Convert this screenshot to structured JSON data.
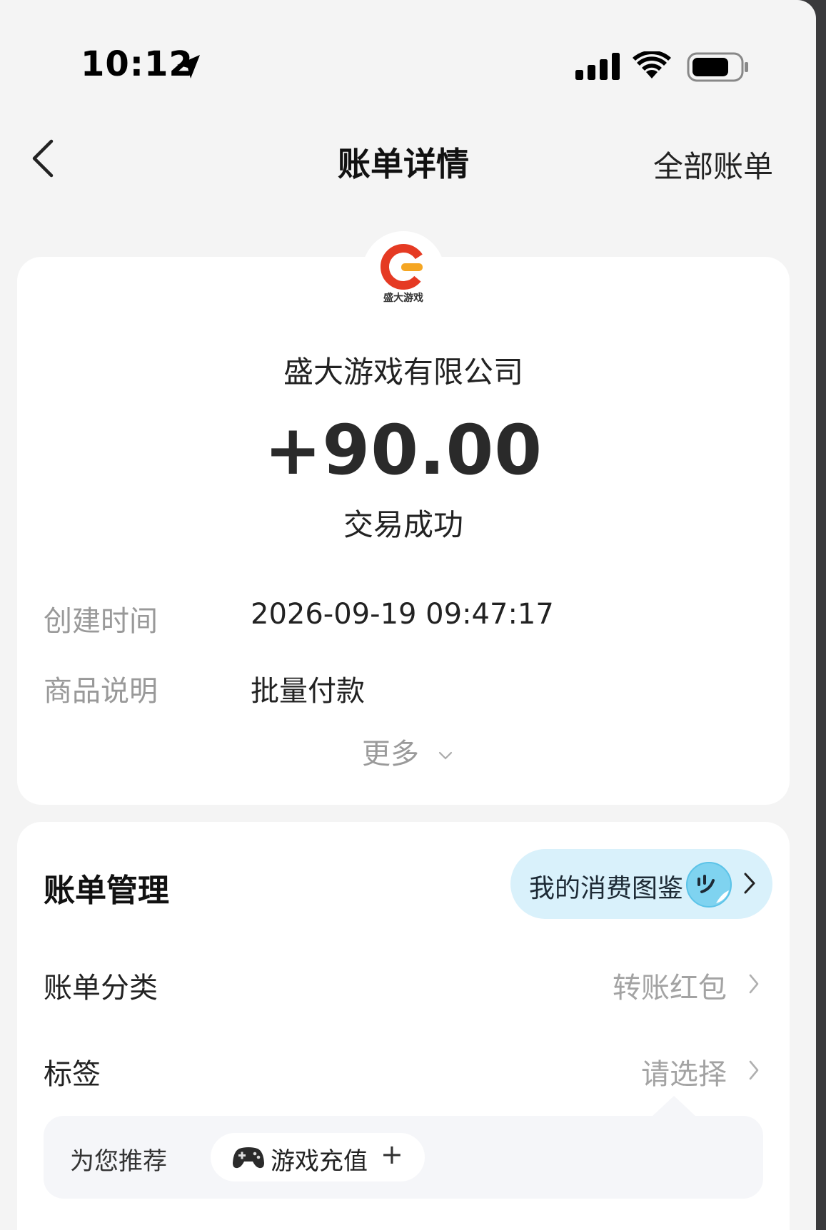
{
  "status_bar": {
    "time": "10:12"
  },
  "nav": {
    "title": "账单详情",
    "right_action": "全部账单"
  },
  "bill": {
    "logo_caption": "盛大游戏",
    "merchant": "盛大游戏有限公司",
    "amount": "+90.00",
    "status": "交易成功",
    "details": [
      {
        "label": "创建时间",
        "value": "2026-09-19 09:47:17"
      },
      {
        "label": "商品说明",
        "value": "批量付款"
      }
    ],
    "more_label": "更多"
  },
  "management": {
    "title": "账单管理",
    "pill_label": "我的消费图鉴",
    "category": {
      "label": "账单分类",
      "value": "转账红包"
    },
    "tag": {
      "label": "标签",
      "value": "请选择"
    },
    "recommend": {
      "label": "为您推荐",
      "chip_label": "游戏充值",
      "chip_plus": "+"
    }
  },
  "colors": {
    "background": "#f4f4f4",
    "card": "#ffffff",
    "pill": "#d9f1fb",
    "logo_red": "#e53a23",
    "logo_orange": "#f5a623"
  }
}
